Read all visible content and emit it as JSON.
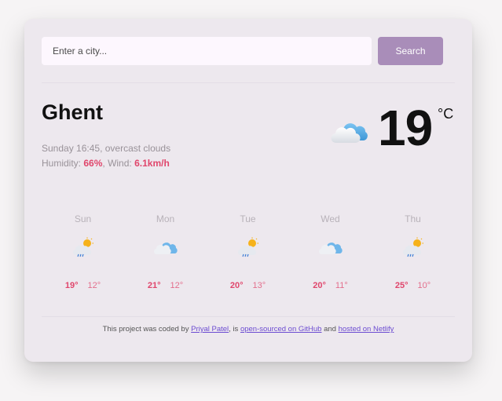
{
  "search": {
    "placeholder": "Enter a city...",
    "value": "",
    "button_label": "Search"
  },
  "current": {
    "city": "Ghent",
    "datetime": "Sunday 16:45",
    "description": "overcast clouds",
    "humidity_label": "Humidity:",
    "humidity": "66%",
    "wind_label": "Wind:",
    "wind": "6.1km/h",
    "temperature": "19",
    "unit": "°C",
    "icon": "overcast-clouds-icon"
  },
  "forecast": [
    {
      "day": "Sun",
      "icon": "light-rain-icon",
      "high": "19°",
      "low": "12°"
    },
    {
      "day": "Mon",
      "icon": "overcast-clouds-icon",
      "high": "21°",
      "low": "12°"
    },
    {
      "day": "Tue",
      "icon": "light-rain-icon",
      "high": "20°",
      "low": "13°"
    },
    {
      "day": "Wed",
      "icon": "overcast-clouds-icon",
      "high": "20°",
      "low": "11°"
    },
    {
      "day": "Thu",
      "icon": "light-rain-icon",
      "high": "25°",
      "low": "10°"
    }
  ],
  "footer": {
    "text1": "This project was coded by",
    "author": "Priyal Patel",
    "text2": ", is",
    "github_link": "open-sourced on GitHub",
    "text3": "and",
    "netlify_link": "hosted on Netlify"
  },
  "colors": {
    "accent": "#a98db9",
    "highlight": "#e0466c",
    "card": "#ede8ee"
  }
}
